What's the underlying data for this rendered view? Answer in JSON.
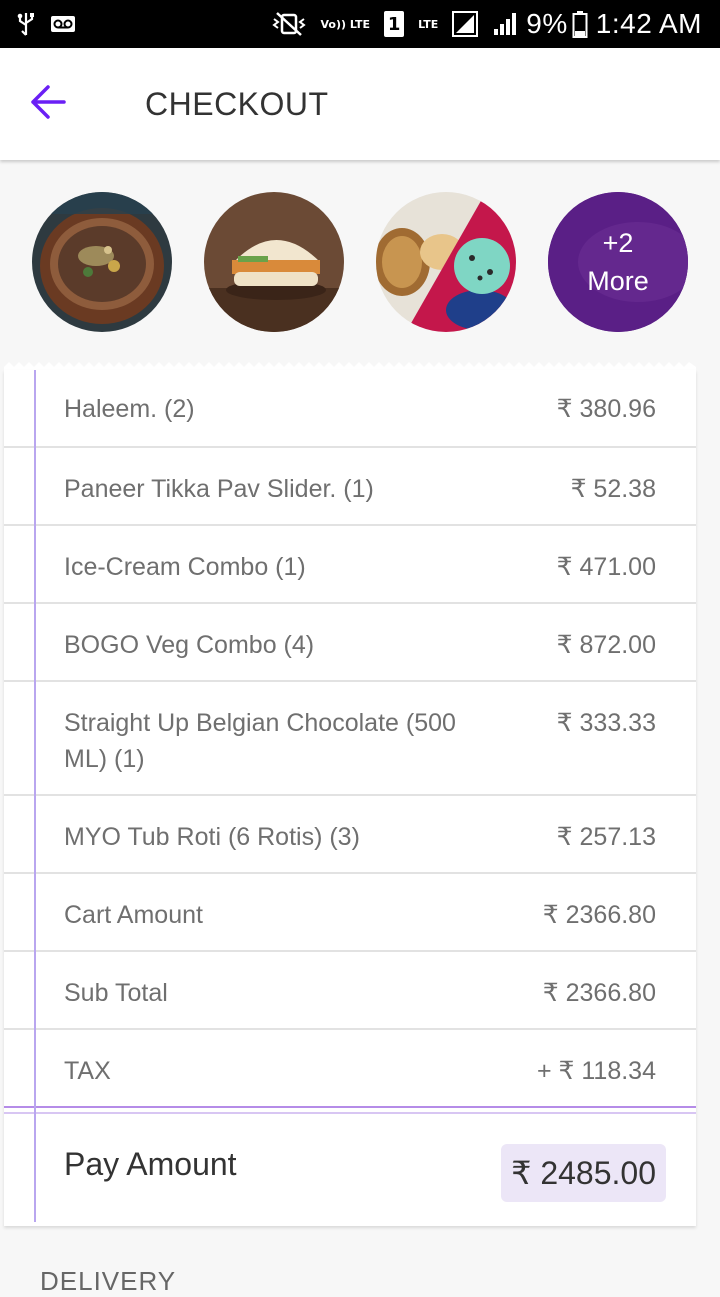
{
  "status_bar": {
    "battery_percent": "9%",
    "time": "1:42 AM",
    "sim_slot": "1",
    "volte_label": "Vo)) LTE",
    "lte_label": "LTE"
  },
  "app_bar": {
    "title": "CHECKOUT"
  },
  "thumbnails": {
    "more_count": "+2",
    "more_label": "More"
  },
  "order_items": [
    {
      "name": "Haleem. (2)",
      "price": "₹ 380.96"
    },
    {
      "name": "Paneer Tikka Pav Slider. (1)",
      "price": "₹ 52.38"
    },
    {
      "name": "Ice-Cream Combo (1)",
      "price": "₹ 471.00"
    },
    {
      "name": "BOGO Veg Combo (4)",
      "price": "₹ 872.00"
    },
    {
      "name": "Straight Up Belgian Chocolate (500 ML) (1)",
      "price": "₹ 333.33"
    },
    {
      "name": "MYO Tub Roti (6 Rotis) (3)",
      "price": "₹ 257.13"
    }
  ],
  "summary": {
    "cart_amount_label": "Cart Amount",
    "cart_amount": "₹ 2366.80",
    "sub_total_label": "Sub Total",
    "sub_total": "₹ 2366.80",
    "tax_label": "TAX",
    "tax": "+ ₹ 118.34",
    "pay_amount_label": "Pay Amount",
    "pay_amount": "₹ 2485.00"
  },
  "next_section_label": "DELIVERY",
  "colors": {
    "accent": "#6a1ff5",
    "more_bg": "#5a1f86",
    "margin_line": "#b9a6ef",
    "pay_bg": "#ece6f7"
  }
}
